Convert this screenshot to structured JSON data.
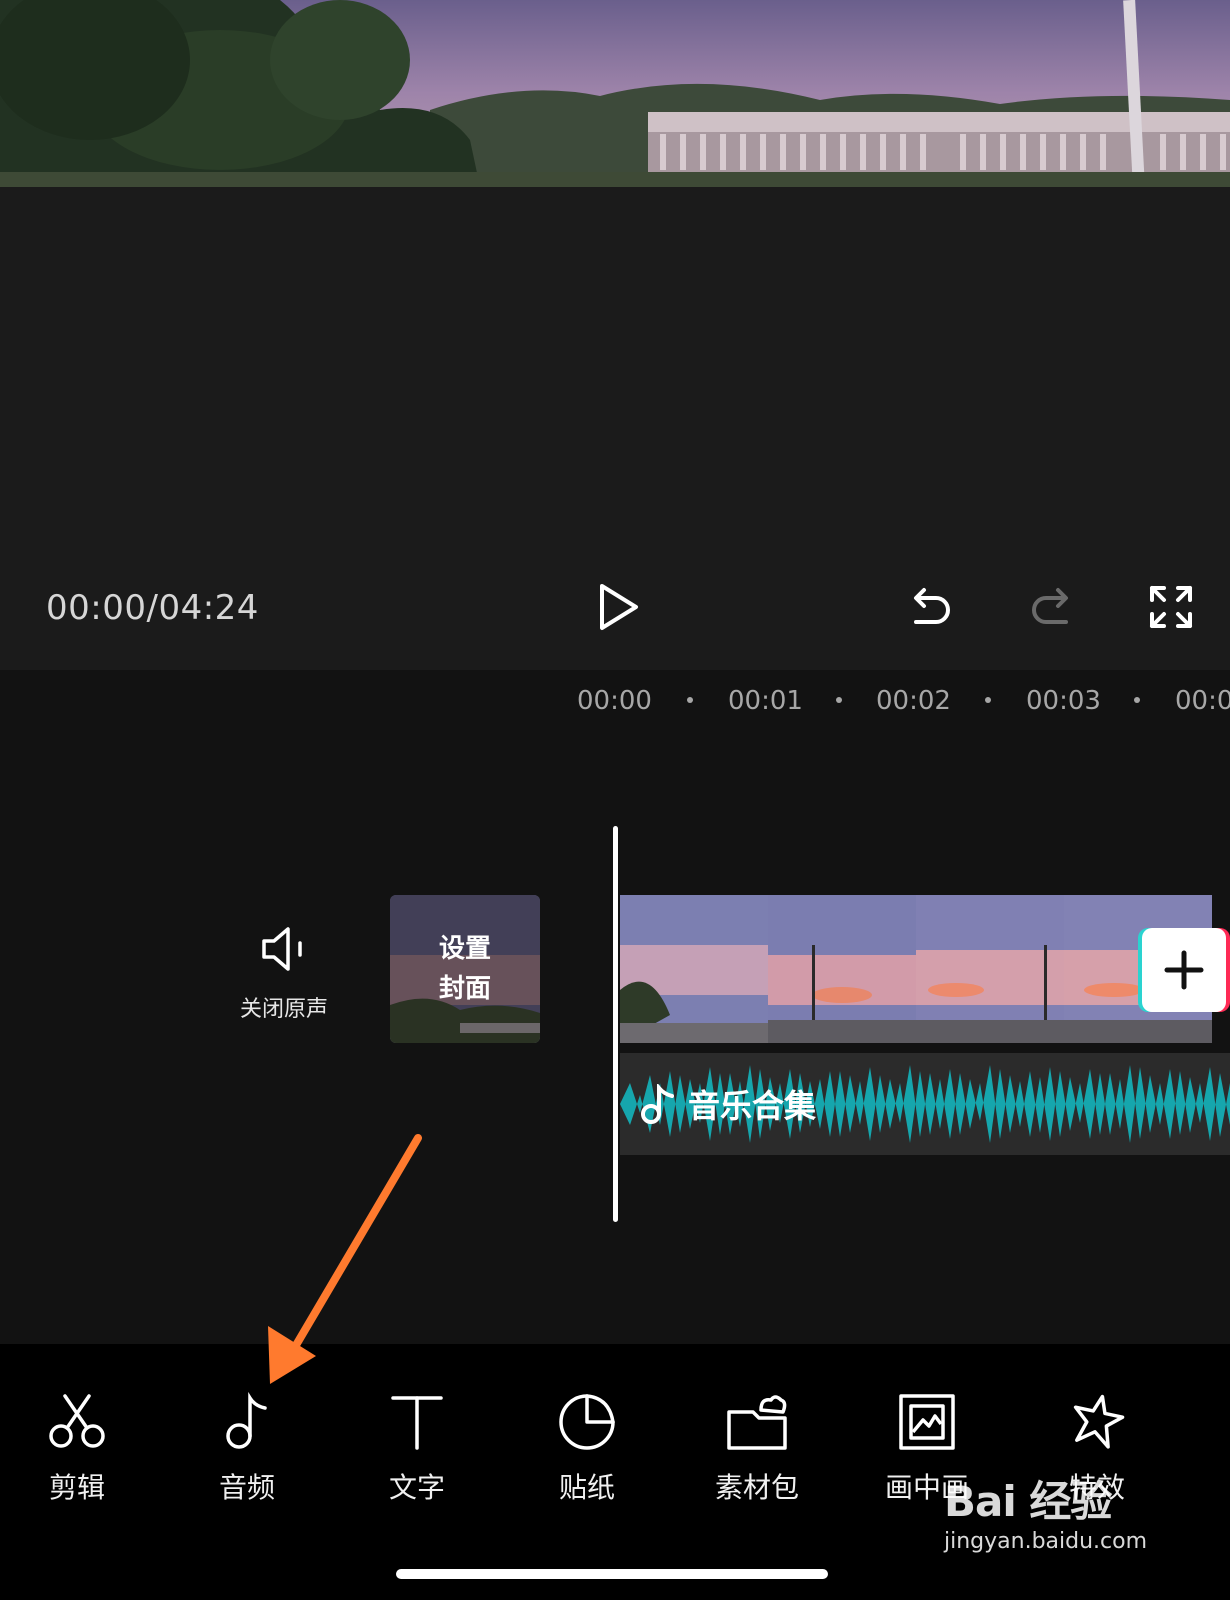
{
  "player": {
    "timecode": "00:00/04:24"
  },
  "timeline": {
    "ruler": [
      "00:00",
      "00:01",
      "00:02",
      "00:03",
      "00:0"
    ],
    "mute_label": "关闭原声",
    "cover_label": "设置\n封面",
    "audio_title": "音乐合集"
  },
  "toolbar": {
    "items": [
      {
        "label": "剪辑",
        "icon": "scissors-icon"
      },
      {
        "label": "音频",
        "icon": "music-note-icon"
      },
      {
        "label": "文字",
        "icon": "text-t-icon"
      },
      {
        "label": "贴纸",
        "icon": "sticker-icon"
      },
      {
        "label": "素材包",
        "icon": "material-pack-icon"
      },
      {
        "label": "画中画",
        "icon": "picture-in-picture-icon"
      },
      {
        "label": "特效",
        "icon": "effects-star-icon"
      }
    ]
  },
  "watermark": {
    "brand": "Bai 经验",
    "url": "jingyan.baidu.com"
  },
  "colors": {
    "audio_wave": "#16a6ad",
    "annotation_arrow": "#ff7a2e"
  }
}
